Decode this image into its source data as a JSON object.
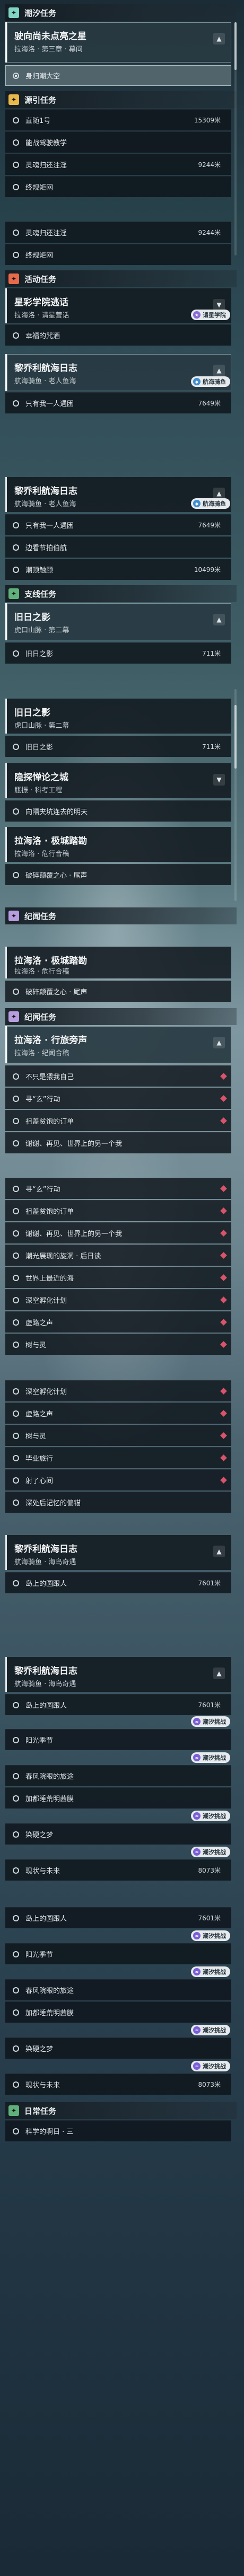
{
  "colors": {
    "tide": "#7fd4c4",
    "guide": "#e8b84a",
    "event": "#e86a4a",
    "side": "#5fb07a",
    "trail": "#b79de0",
    "daily": "#5fb07a",
    "diamond": "#d9536a"
  },
  "sections": {
    "tide1": "潮汐任务",
    "guide1": "源引任务",
    "event1": "活动任务",
    "side1": "支线任务",
    "trail1": "纪闻任务",
    "trail2": "纪闻任务",
    "daily1": "日常任务"
  },
  "cards": {
    "c1": {
      "title": "驶向尚未点亮之星",
      "sub": "拉海洛 · 第三章 · 幕间"
    },
    "c2": {
      "title": "星彩学院逃话",
      "sub": "拉海洛 · 请星营话"
    },
    "c3": {
      "title": "黎乔利航海日志",
      "sub": "航海骑鱼 · 老人鱼海"
    },
    "c4": {
      "title": "黎乔利航海日志",
      "sub": "航海骑鱼 · 老人鱼海"
    },
    "c5": {
      "title": "旧日之影",
      "sub": "虎口山脉 · 第二幕"
    },
    "c6": {
      "title": "旧日之影",
      "sub": "虎口山脉 · 第二幕"
    },
    "c7": {
      "title": "隐探惮论之城",
      "sub": "瓶振 · 科考工程"
    },
    "c8": {
      "title": "拉海洛 · 极城踏勘",
      "sub": "拉海洛 · 危行合稿"
    },
    "c9": {
      "title": "拉海洛 · 极城踏勘",
      "sub": "拉海洛 · 危行合稿"
    },
    "c10": {
      "title": "拉海洛 · 行旅旁声",
      "sub": "拉海洛 · 纪闻合稿"
    },
    "c11": {
      "title": "黎乔利航海日志",
      "sub": "航海骑鱼 · 海鸟奇遇"
    },
    "c12": {
      "title": "黎乔利航海日志",
      "sub": "航海骑鱼 · 海鸟奇遇"
    },
    "c13": {
      "title": "拉海洛 · 极城踏勘",
      "sub": "拉海洛 · 危行合稿"
    }
  },
  "rows": {
    "r1": {
      "text": "身归潮大空"
    },
    "r2": {
      "text": "直随1号",
      "dist": "15309米"
    },
    "r3": {
      "text": "能战驾驶教学"
    },
    "r4": {
      "text": "灵魂归还注淫",
      "dist": "9244米"
    },
    "r5": {
      "text": "终规矩网"
    },
    "r6": {
      "text": "灵魂归还注淫",
      "dist": "9244米"
    },
    "r7": {
      "text": "终规矩网"
    },
    "r8": {
      "text": "幸福的咒酒"
    },
    "r9": {
      "text": "只有我一人遇困",
      "dist": "7649米"
    },
    "r10": {
      "text": "只有我一人遇困",
      "dist": "7649米"
    },
    "r11": {
      "text": "边看节拍伯航"
    },
    "r12": {
      "text": "潮顶触顾",
      "dist": "10499米"
    },
    "r13": {
      "text": "旧日之影",
      "dist": "711米"
    },
    "r14": {
      "text": "旧日之影",
      "dist": "711米"
    },
    "r15": {
      "text": "向隔夹坑连去的明天"
    },
    "r16": {
      "text": "破碎颠覆之心 · 尾声"
    },
    "r17": {
      "text": "破碎颠覆之心 · 尾声"
    },
    "r18": {
      "text": "不只是猥我自己"
    },
    "r19": {
      "text": "寻“玄”行动"
    },
    "r20": {
      "text": "祖盖贫饱的订单"
    },
    "r21": {
      "text": "谢谢、再见、世界上的另一个我"
    },
    "r22": {
      "text": "寻“玄”行动"
    },
    "r23": {
      "text": "祖盖贫饱的订单"
    },
    "r24": {
      "text": "谢谢、再见、世界上的另一个我"
    },
    "r25": {
      "text": "潮光展现的旋洞 · 后日谈"
    },
    "r26": {
      "text": "世界上最近的海"
    },
    "r27": {
      "text": "深空孵化计划"
    },
    "r28": {
      "text": "虚路之声"
    },
    "r29": {
      "text": "树与灵"
    },
    "r30": {
      "text": "深空孵化计划"
    },
    "r31": {
      "text": "虚路之声"
    },
    "r32": {
      "text": "树与灵"
    },
    "r33": {
      "text": "毕业旅行"
    },
    "r34": {
      "text": "射了心间"
    },
    "r35": {
      "text": "深处后记忆的偏锚"
    },
    "r36": {
      "text": "岛上的圆跟人",
      "dist": "7601米"
    },
    "r37": {
      "text": "岛上的圆跟人",
      "dist": "7601米"
    },
    "r38": {
      "text": "阳光季节"
    },
    "r39": {
      "text": "春风院眼的旅途"
    },
    "r40": {
      "text": "加都睡荒明茜膜"
    },
    "r41": {
      "text": "染硬之梦"
    },
    "r42": {
      "text": "现状与未来",
      "dist": "8073米"
    },
    "r43": {
      "text": "岛上的圆跟人",
      "dist": "7601米"
    },
    "r44": {
      "text": "阳光季节"
    },
    "r45": {
      "text": "春风院眼的旅途"
    },
    "r46": {
      "text": "加都睡荒明茜膜"
    },
    "r47": {
      "text": "染硬之梦"
    },
    "r48": {
      "text": "现状与未来",
      "dist": "8073米"
    },
    "r49": {
      "text": "科学的啊日 · 三"
    }
  },
  "pills": {
    "p1": {
      "label": "请星学院",
      "icon": "star-icon"
    },
    "p2": {
      "label": "航海骑鱼",
      "icon": "fish-icon"
    },
    "p3": {
      "label": "航海骑鱼",
      "icon": "fish-icon"
    },
    "p4": {
      "label": "航海骑鱼",
      "icon": "fish-icon"
    },
    "p5": {
      "label": "潮汐挑战",
      "icon": "wave-icon"
    },
    "p6": {
      "label": "潮汐挑战",
      "icon": "wave-icon"
    },
    "p7": {
      "label": "潮汐挑战",
      "icon": "wave-icon"
    },
    "p8": {
      "label": "潮汐挑战",
      "icon": "wave-icon"
    },
    "p9": {
      "label": "潮汐挑战",
      "icon": "wave-icon"
    },
    "p10": {
      "label": "潮汐挑战",
      "icon": "wave-icon"
    },
    "p11": {
      "label": "潮汐挑战",
      "icon": "wave-icon"
    },
    "p12": {
      "label": "潮汐挑战",
      "icon": "wave-icon"
    },
    "p13": {
      "label": "潮汐挑战",
      "icon": "wave-icon"
    },
    "p14": {
      "label": "潮汐挑战",
      "icon": "wave-icon"
    },
    "p15": {
      "label": "潮汐挑战",
      "icon": "wave-icon"
    }
  }
}
